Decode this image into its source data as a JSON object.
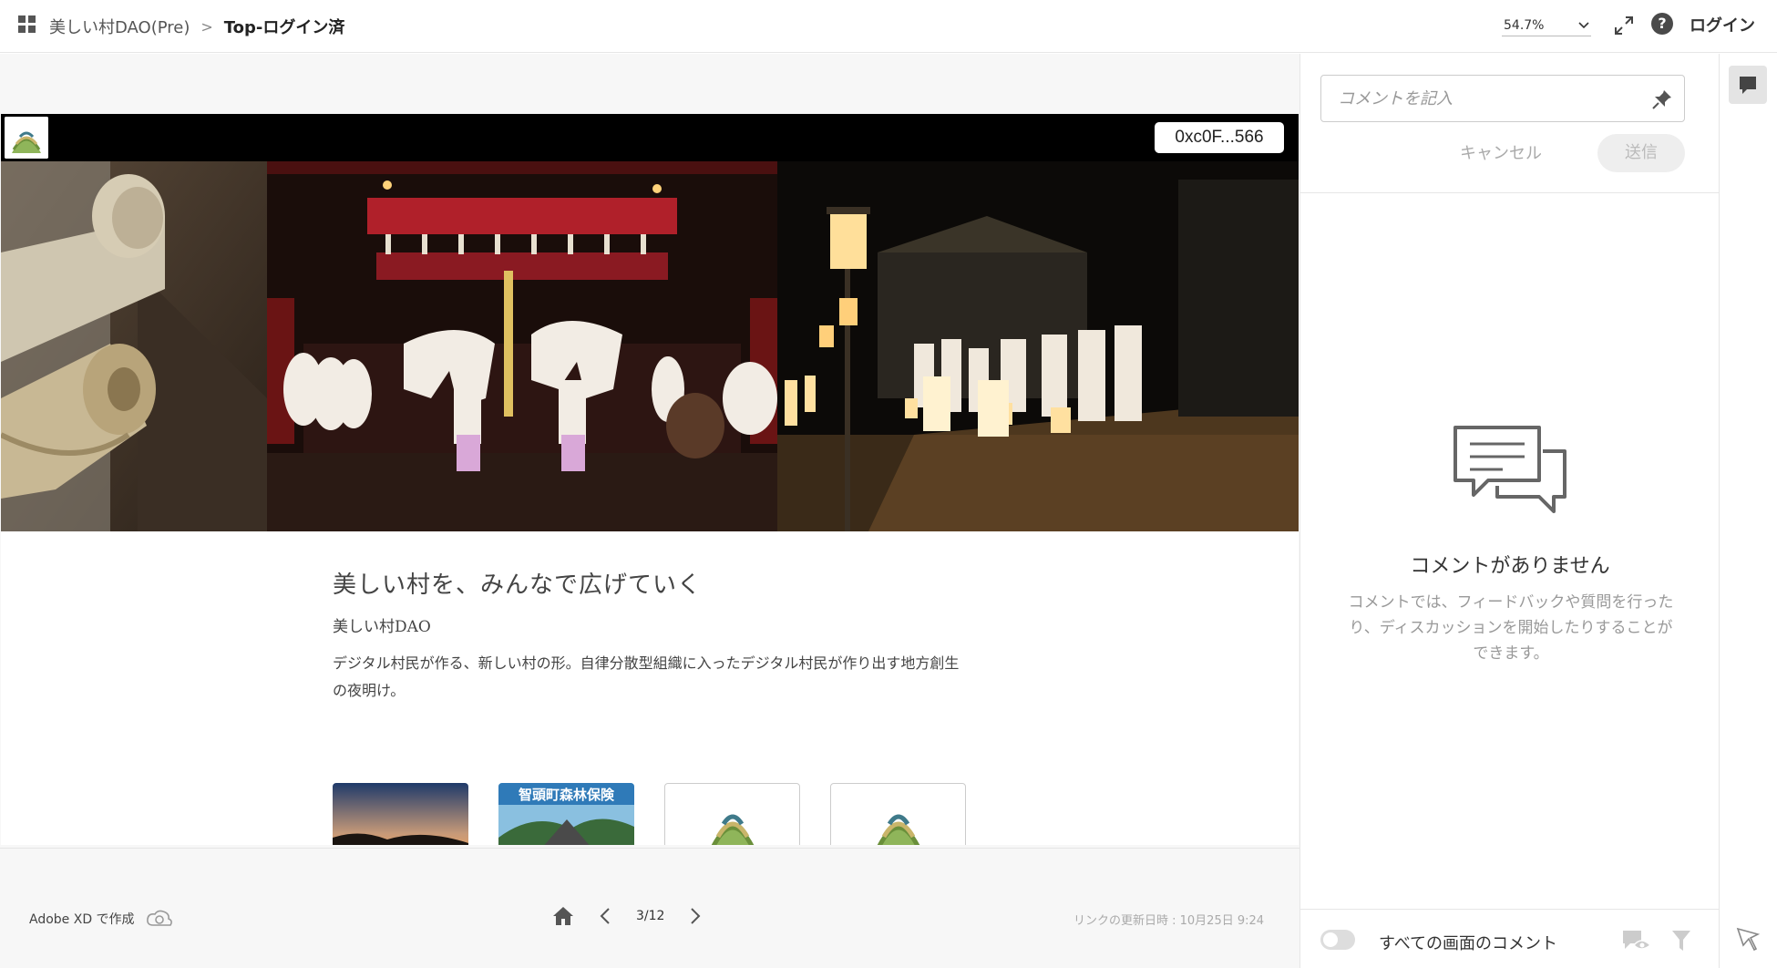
{
  "header": {
    "project_name": "美しい村DAO(Pre)",
    "separator": ">",
    "screen_name": "Top-ログイン済",
    "zoom": "54.7%",
    "login_label": "ログイン",
    "help_glyph": "?"
  },
  "artboard": {
    "wallet_address": "0xc0F...566",
    "title": "美しい村を、みんなで広げていく",
    "subtitle": "美しい村DAO",
    "description": "デジタル村民が作る、新しい村の形。自律分散型組織に入ったデジタル村民が作り出す地方創生の夜明け。",
    "thumbnail_banner_text": "智頭町森林保険",
    "hero_images": [
      "woven-fabric-rolls",
      "night-kagura-dance",
      "lantern-festival-street"
    ]
  },
  "footer": {
    "made_with": "Adobe XD で作成",
    "page_indicator": "3/12",
    "updated": "リンクの更新日時 : 10月25日 9:24"
  },
  "comments": {
    "placeholder": "コメントを記入",
    "cancel_label": "キャンセル",
    "send_label": "送信",
    "empty_title": "コメントがありません",
    "empty_description": "コメントでは、フィードバックや質問を行ったり、ディスカッションを開始したりすることができます。",
    "all_screens_label": "すべての画面のコメント"
  },
  "colors": {
    "accent_dark": "#4a4a4a",
    "panel_border": "#e6e6e6",
    "canvas_bg": "#f7f7f7"
  }
}
